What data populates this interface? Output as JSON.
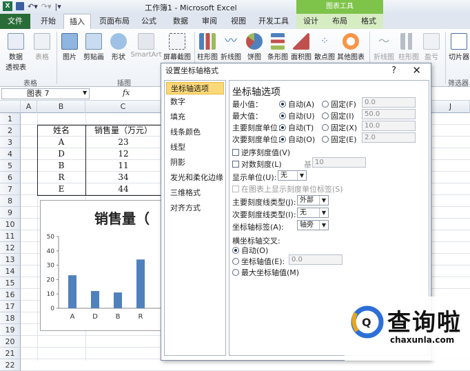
{
  "window": {
    "title": "工作簿1 - Microsoft Excel",
    "chart_tools": "图表工具"
  },
  "tabs": [
    "文件",
    "开始",
    "插入",
    "页面布局",
    "公式",
    "数据",
    "审阅",
    "视图",
    "开发工具",
    "设计",
    "布局",
    "格式"
  ],
  "ribbon": {
    "buttons": [
      "数据",
      "透视表",
      "表格",
      "图片",
      "剪贴画",
      "形状",
      "SmartArt",
      "屏幕截图",
      "柱形图",
      "折线图",
      "饼图",
      "条形图",
      "面积图",
      "散点图",
      "其他图表",
      "折线图",
      "柱形图",
      "盈亏",
      "切片器"
    ],
    "groups": [
      "表格",
      "插图",
      "筛选器"
    ]
  },
  "formula_bar": {
    "name_box": "图表 7",
    "fx": "fx"
  },
  "columns": [
    "A",
    "B",
    "C",
    "J"
  ],
  "rows": [
    "1",
    "2",
    "3",
    "4",
    "5",
    "6",
    "7",
    "8",
    "9",
    "10",
    "11",
    "12",
    "13",
    "14",
    "15",
    "16",
    "17",
    "18",
    "19",
    "20",
    "21",
    "22"
  ],
  "table": {
    "headers": [
      "姓名",
      "销售量（万元）"
    ],
    "rows": [
      [
        "A",
        "23"
      ],
      [
        "D",
        "12"
      ],
      [
        "B",
        "11"
      ],
      [
        "R",
        "34"
      ],
      [
        "E",
        "44"
      ]
    ]
  },
  "chart_data": {
    "type": "bar",
    "title": "销售量（",
    "categories": [
      "A",
      "D",
      "B",
      "R"
    ],
    "values": [
      23,
      12,
      11,
      34
    ],
    "ylim": [
      0,
      50
    ],
    "yticks": [
      "0",
      "10",
      "20",
      "30",
      "40",
      "50"
    ],
    "bar_color": "#4f81bd"
  },
  "dialog": {
    "title": "设置坐标轴格式",
    "help": "?",
    "close": "✕",
    "nav": [
      "坐标轴选项",
      "数字",
      "填充",
      "线条颜色",
      "线型",
      "阴影",
      "发光和柔化边缘",
      "三维格式",
      "对齐方式"
    ],
    "section_title": "坐标轴选项",
    "axis_rows": [
      {
        "label": "最小值：",
        "auto": "自动(A)",
        "fixed": "固定(F)",
        "value": "0.0"
      },
      {
        "label": "最大值：",
        "auto": "自动(U)",
        "fixed": "固定(I)",
        "value": "50.0"
      },
      {
        "label": "主要刻度单位：",
        "auto": "自动(T)",
        "fixed": "固定(X)",
        "value": "10.0"
      },
      {
        "label": "次要刻度单位：",
        "auto": "自动(O)",
        "fixed": "固定(E)",
        "value": "2.0"
      }
    ],
    "reverse_order": "逆序刻度值(V)",
    "log_scale": "对数刻度(L)",
    "base_label": "基(B):",
    "base_value": "10",
    "display_units_label": "显示单位(U):",
    "display_units_value": "无",
    "show_units_label": "在图表上显示刻度单位标签(S)",
    "major_tick_label": "主要刻度线类型(J):",
    "major_tick_value": "外部",
    "minor_tick_label": "次要刻度线类型(I):",
    "minor_tick_value": "无",
    "axis_labels_label": "坐标轴标签(A):",
    "axis_labels_value": "轴旁",
    "cross_title": "横坐标轴交叉:",
    "cross_auto": "自动(O)",
    "cross_value_label": "坐标轴值(E):",
    "cross_value": "0.0",
    "cross_max": "最大坐标轴值(M)"
  },
  "watermark": {
    "brand": "查询啦",
    "url": "chaxunla.com"
  }
}
